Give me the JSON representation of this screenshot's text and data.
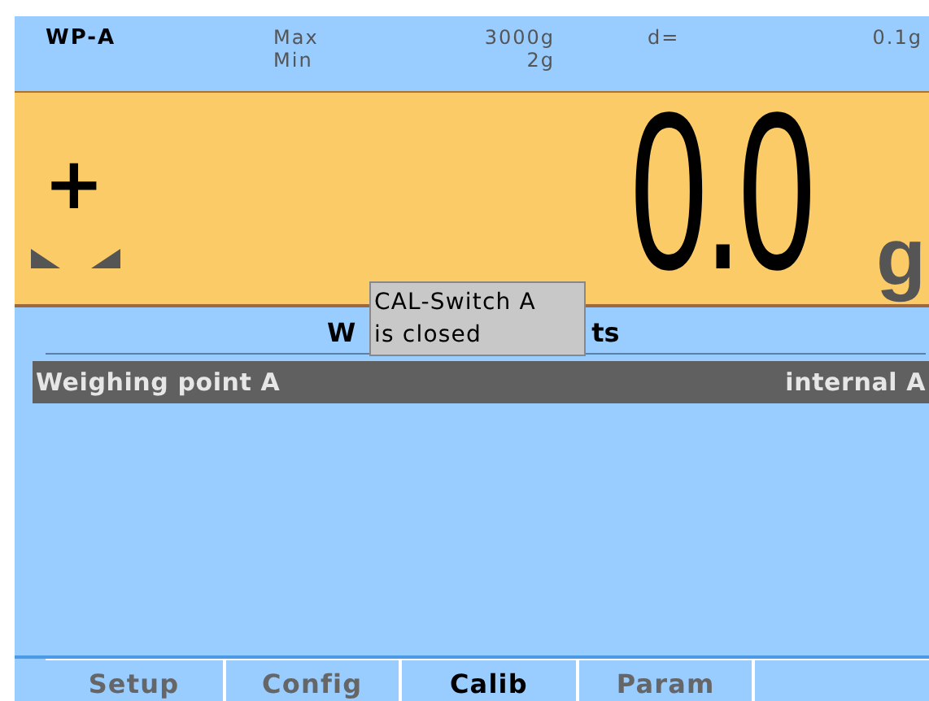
{
  "header": {
    "device": "WP-A",
    "max_label": "Max",
    "max_value": "3000g",
    "min_label": "Min",
    "min_value": "2g",
    "d_label": "d=",
    "d_value": "0.1g"
  },
  "display": {
    "sign": "+",
    "value": "0.0",
    "unit": "g",
    "stable": true
  },
  "section": {
    "title_parts": [
      "W",
      "ts"
    ]
  },
  "rows": [
    {
      "name": "Weighing point A",
      "value": "internal A",
      "selected": true
    }
  ],
  "tooltip": {
    "lines": [
      "CAL-Switch A",
      "is closed"
    ]
  },
  "tabs": [
    {
      "label": "Setup",
      "selected": false
    },
    {
      "label": "Config",
      "selected": false
    },
    {
      "label": "Calib",
      "selected": true
    },
    {
      "label": "Param",
      "selected": false
    }
  ]
}
